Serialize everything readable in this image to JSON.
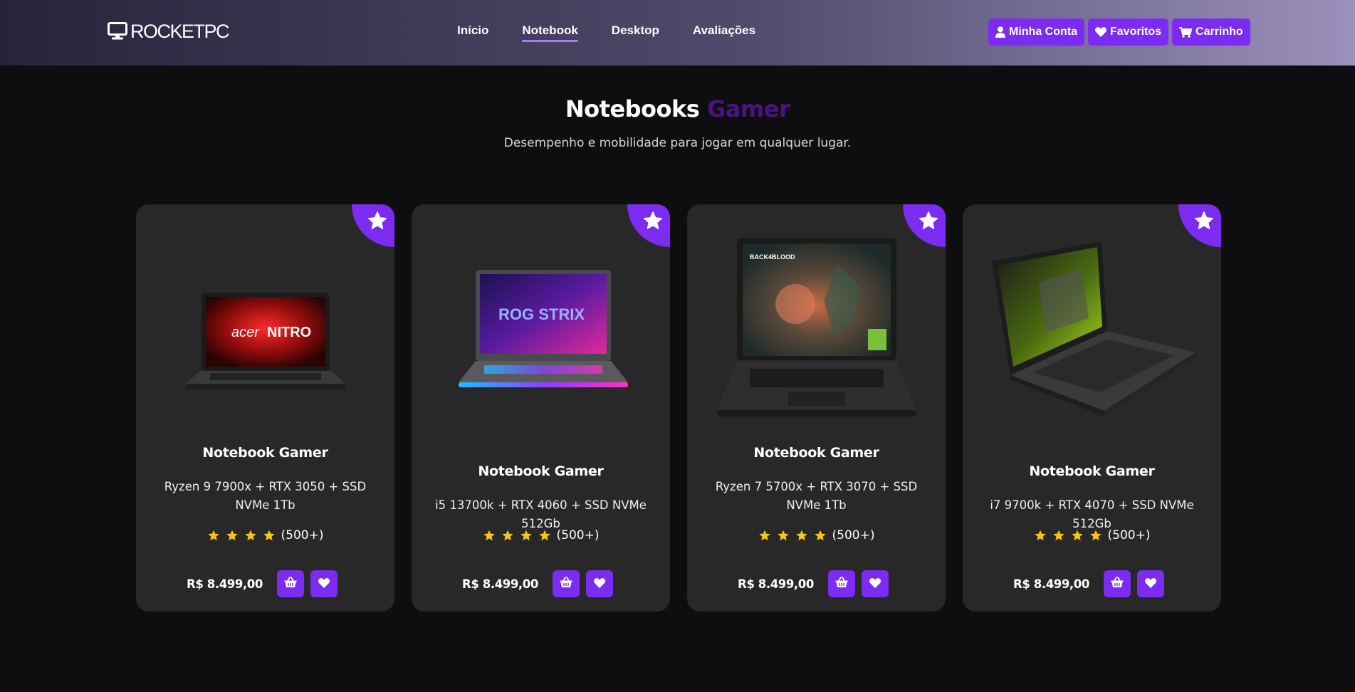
{
  "brand": {
    "name": "ROCKETPC",
    "logo_icon": "monitor-icon"
  },
  "nav": {
    "items": [
      {
        "label": "Início"
      },
      {
        "label": "Notebook",
        "active": true
      },
      {
        "label": "Desktop"
      },
      {
        "label": "Avaliações"
      }
    ]
  },
  "header_actions": {
    "account": {
      "label": "Minha Conta",
      "icon": "user-icon"
    },
    "favorites": {
      "label": "Favoritos",
      "icon": "heart-icon"
    },
    "cart": {
      "label": "Carrinho",
      "icon": "cart-icon"
    }
  },
  "section": {
    "title_main": "Notebooks",
    "title_accent": "Gamer",
    "subtitle": "Desempenho e mobilidade para jogar em qualquer lugar."
  },
  "colors": {
    "accent": "#7c2bf0",
    "accent_dark": "#4a1480",
    "star": "#f5c518",
    "card_bg": "#282828",
    "page_bg": "#0e0e10"
  },
  "products": [
    {
      "title": "Notebook Gamer",
      "spec": "Ryzen 9 7900x + RTX 3050 + SSD NVMe 1Tb",
      "rating_count": "(500+)",
      "stars": 4,
      "price": "R$ 8.499,00",
      "image": "acer-nitro-laptop"
    },
    {
      "title": "Notebook Gamer",
      "spec": "i5 13700k + RTX 4060 + SSD NVMe 512Gb",
      "rating_count": "(500+)",
      "stars": 4,
      "price": "R$ 8.499,00",
      "image": "asus-rog-strix-laptop"
    },
    {
      "title": "Notebook Gamer",
      "spec": "Ryzen 7 5700x + RTX 3070 + SSD NVMe 1Tb",
      "rating_count": "(500+)",
      "stars": 4,
      "price": "R$ 8.499,00",
      "image": "game-screen-laptop"
    },
    {
      "title": "Notebook Gamer",
      "spec": "i7 9700k + RTX 4070 + SSD NVMe 512Gb",
      "rating_count": "(500+)",
      "stars": 4,
      "price": "R$ 8.499,00",
      "image": "rtx-screen-laptop"
    }
  ]
}
